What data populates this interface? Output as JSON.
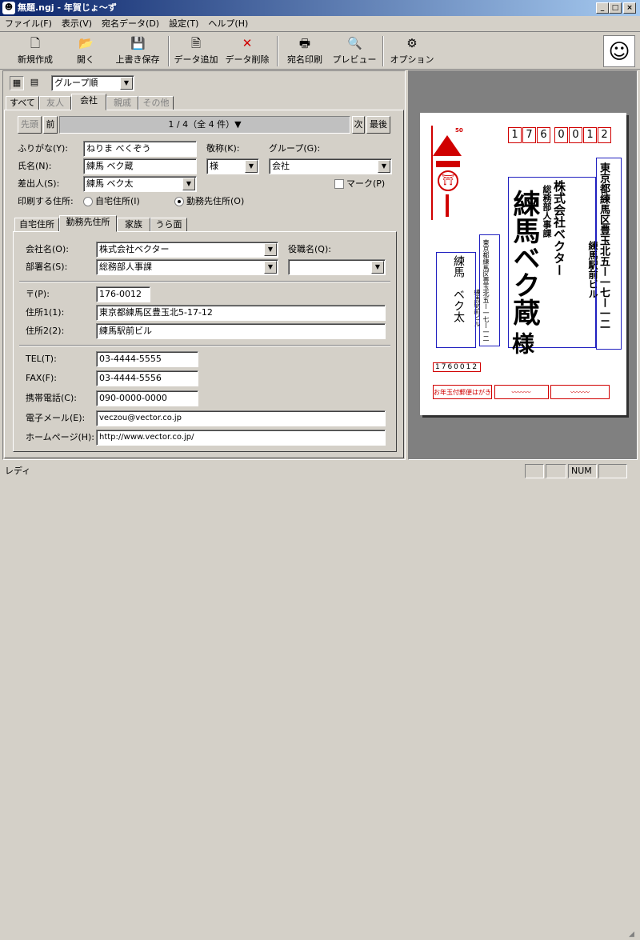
{
  "window": {
    "title": "無題.ngj - 年賀じょ〜ず",
    "min": "_",
    "max": "□",
    "close": "×"
  },
  "menu": [
    "ファイル(F)",
    "表示(V)",
    "宛名データ(D)",
    "設定(T)",
    "ヘルプ(H)"
  ],
  "toolbar": {
    "new": "新規作成",
    "open": "開く",
    "save": "上書き保存",
    "add": "データ追加",
    "delete": "データ削除",
    "print": "宛名印刷",
    "preview": "プレビュー",
    "options": "オプション"
  },
  "view": {
    "sort": "グループ順"
  },
  "tabs": [
    "すべて",
    "友人",
    "会社",
    "親戚",
    "その他"
  ],
  "nav": {
    "first": "先頭",
    "prev": "前",
    "position": "1 / 4（全 4 件）▼",
    "next": "次",
    "last": "最後"
  },
  "form": {
    "furigana_label": "ふりがな(Y):",
    "furigana": "ねりま べくぞう",
    "title_label": "敬称(K):",
    "title": "様",
    "group_label": "グループ(G):",
    "group": "会社",
    "name_label": "氏名(N):",
    "name": "練馬 ベク蔵",
    "sender_label": "差出人(S):",
    "sender": "練馬 ベク太",
    "mark_label": "マーク(P)",
    "print_addr_label": "印刷する住所:",
    "home_opt": "自宅住所(I)",
    "work_opt": "勤務先住所(O)"
  },
  "subtabs": [
    "自宅住所",
    "勤務先住所",
    "家族",
    "うら面"
  ],
  "work": {
    "company_label": "会社名(O):",
    "company": "株式会社ベクター",
    "position_label": "役職名(Q):",
    "position": "",
    "dept_label": "部署名(S):",
    "dept": "総務部人事課",
    "zip_label": "〒(P):",
    "zip": "176-0012",
    "addr1_label": "住所1(1):",
    "addr1": "東京都練馬区豊玉北5-17-12",
    "addr2_label": "住所2(2):",
    "addr2": "練馬駅前ビル",
    "tel_label": "TEL(T):",
    "tel": "03-4444-5555",
    "fax_label": "FAX(F):",
    "fax": "03-4444-5556",
    "mobile_label": "携帯電話(C):",
    "mobile": "090-0000-0000",
    "email_label": "電子メール(E):",
    "email": "veczou@vector.co.jp",
    "web_label": "ホームページ(H):",
    "web": "http://www.vector.co.jp/"
  },
  "card": {
    "zip_digits": [
      "1",
      "7",
      "6",
      "0",
      "0",
      "1",
      "2"
    ],
    "address": "東京都練馬区豊玉北五ー一七ー一二",
    "building": "練馬駅前ビル",
    "company": "株式会社ベクター",
    "dept": "総務部人事課",
    "name": "練馬ベク蔵",
    "honorific": "様",
    "sender_name": "練馬　ベク太",
    "sender_addr": "東京都練馬区豊玉北五ー一七ー一二",
    "sender_bldg": "練馬駅前ビル",
    "sender_zip": "1760012",
    "stamp_value": "50",
    "lottery_text": "お年玉付郵便はがき"
  },
  "status": {
    "text": "レディ",
    "num": "NUM"
  }
}
